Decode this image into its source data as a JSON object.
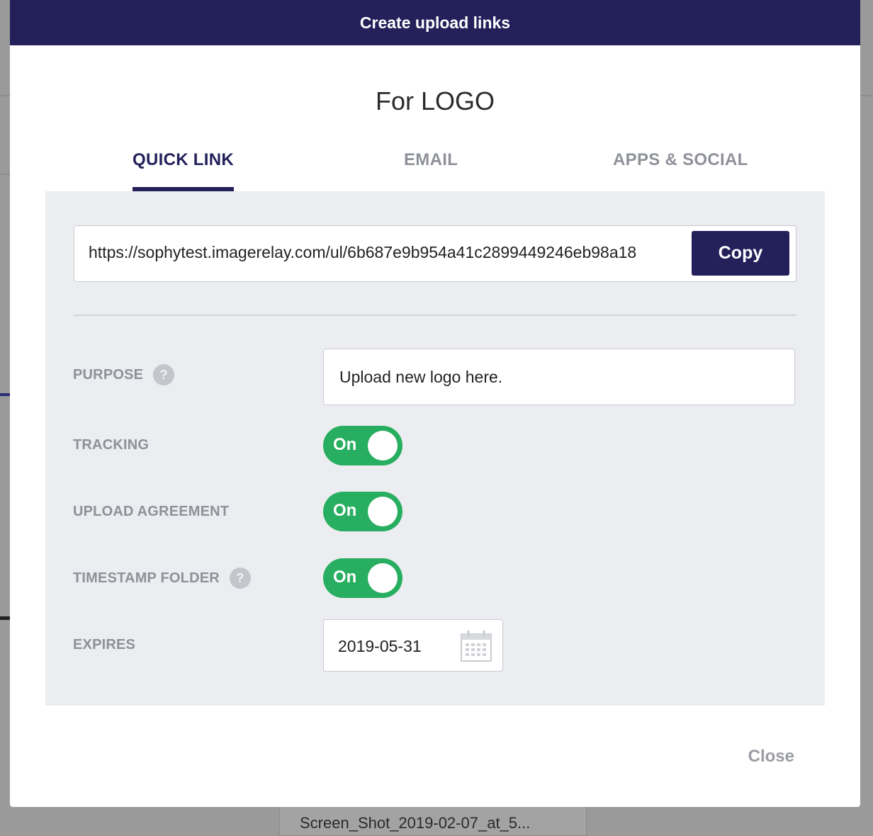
{
  "modal": {
    "title": "Create upload links",
    "subtitle": "For LOGO",
    "close_label": "Close"
  },
  "tabs": [
    {
      "label": "QUICK LINK",
      "active": true
    },
    {
      "label": "EMAIL",
      "active": false
    },
    {
      "label": "APPS & SOCIAL",
      "active": false
    }
  ],
  "quick_link": {
    "url": "https://sophytest.imagerelay.com/ul/6b687e9b954a41c2899449246eb98a18",
    "copy_label": "Copy"
  },
  "settings": {
    "purpose": {
      "label": "PURPOSE",
      "value": "Upload new logo here.",
      "help": "?"
    },
    "tracking": {
      "label": "TRACKING",
      "state": "On"
    },
    "upload_agreement": {
      "label": "UPLOAD AGREEMENT",
      "state": "On"
    },
    "timestamp_folder": {
      "label": "TIMESTAMP FOLDER",
      "state": "On",
      "help": "?"
    },
    "expires": {
      "label": "EXPIRES",
      "value": "2019-05-31"
    }
  },
  "background": {
    "card_text": "Screen_Shot_2019-02-07_at_5..."
  },
  "colors": {
    "header": "#23205a",
    "toggle_on": "#27ae60",
    "panel": "#ecedf0"
  }
}
